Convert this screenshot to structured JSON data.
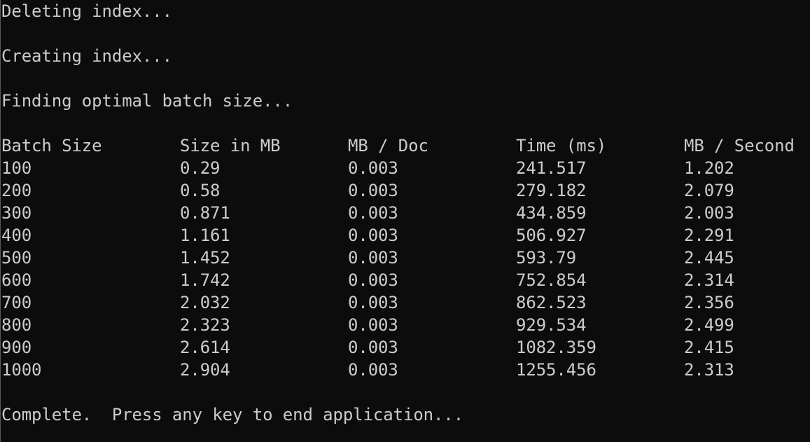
{
  "console": {
    "messages": {
      "deleting": "Deleting index...",
      "creating": "Creating index...",
      "finding": "Finding optimal batch size...",
      "complete": "Complete.  Press any key to end application..."
    },
    "table": {
      "headers": [
        "Batch Size",
        "Size in MB",
        "MB / Doc",
        "Time (ms)",
        "MB / Second"
      ],
      "rows": [
        [
          "100",
          "0.29",
          "0.003",
          "241.517",
          "1.202"
        ],
        [
          "200",
          "0.58",
          "0.003",
          "279.182",
          "2.079"
        ],
        [
          "300",
          "0.871",
          "0.003",
          "434.859",
          "2.003"
        ],
        [
          "400",
          "1.161",
          "0.003",
          "506.927",
          "2.291"
        ],
        [
          "500",
          "1.452",
          "0.003",
          "593.79",
          "2.445"
        ],
        [
          "600",
          "1.742",
          "0.003",
          "752.854",
          "2.314"
        ],
        [
          "700",
          "2.032",
          "0.003",
          "862.523",
          "2.356"
        ],
        [
          "800",
          "2.323",
          "0.003",
          "929.534",
          "2.499"
        ],
        [
          "900",
          "2.614",
          "0.003",
          "1082.359",
          "2.415"
        ],
        [
          "1000",
          "2.904",
          "0.003",
          "1255.456",
          "2.313"
        ]
      ]
    },
    "colors": {
      "background": "#0c0c0c",
      "text": "#cccccc"
    }
  }
}
